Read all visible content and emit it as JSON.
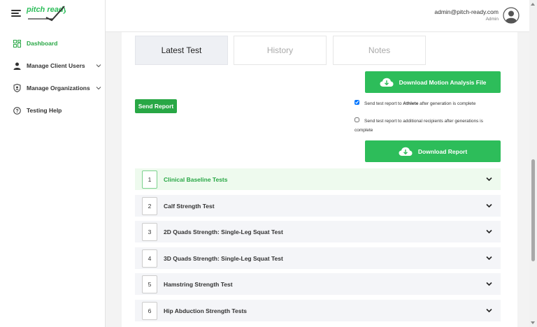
{
  "brand": {
    "logo_text": "pitch ready"
  },
  "sidebar": {
    "items": [
      {
        "label": "Dashboard"
      },
      {
        "label": "Manage Client Users"
      },
      {
        "label": "Manage Organizations"
      },
      {
        "label": "Testing Help"
      }
    ]
  },
  "user": {
    "email": "admin@pitch-ready.com",
    "role": "Admin"
  },
  "tabs": [
    {
      "label": "Latest Test"
    },
    {
      "label": "History"
    },
    {
      "label": "Notes"
    }
  ],
  "actions": {
    "download_motion_label": "Download Motion Analysis File",
    "send_report_label": "Send Report",
    "download_report_label": "Download Report"
  },
  "options": {
    "athlete_prefix": "Send test report to ",
    "athlete_bold": "Athlete",
    "athlete_suffix": " after generation is complete",
    "athlete_checked": true,
    "recipients_text": "Send test report to additional recipients after generations is complete",
    "recipients_checked": false
  },
  "tests": [
    {
      "num": "1",
      "title": "Clinical Baseline Tests"
    },
    {
      "num": "2",
      "title": "Calf Strength Test"
    },
    {
      "num": "3",
      "title": "2D Quads Strength: Single-Leg Squat Test"
    },
    {
      "num": "4",
      "title": "3D Quads Strength: Single-Leg Squat Test"
    },
    {
      "num": "5",
      "title": "Hamstring Strength Test"
    },
    {
      "num": "6",
      "title": "Hip Abduction Strength Tests"
    }
  ],
  "colors": {
    "accent": "#28a745",
    "button": "#2dbd5a",
    "active_row": "#eefaee"
  }
}
